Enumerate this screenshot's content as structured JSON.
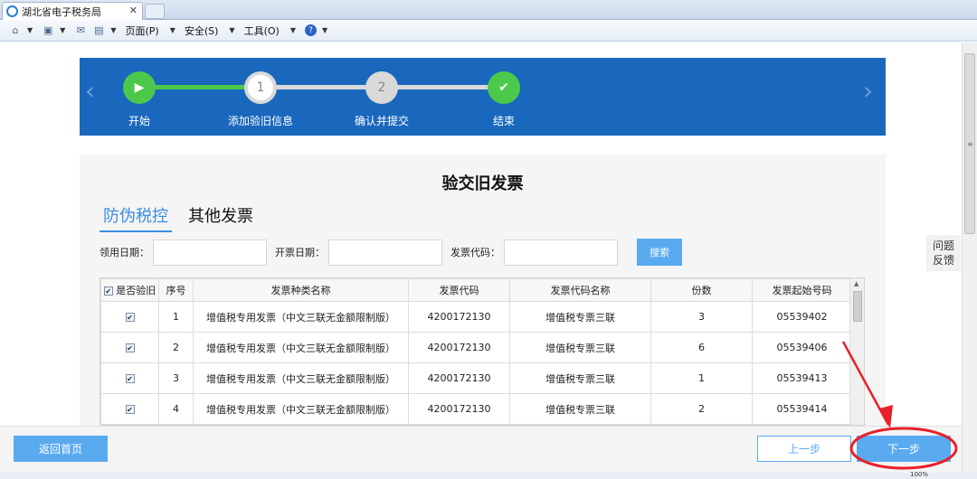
{
  "browser": {
    "tab_title": "湖北省电子税务局",
    "tab_close": "✕",
    "menus": [
      "页面(P)",
      "安全(S)",
      "工具(O)"
    ],
    "help_glyph": "?"
  },
  "steps": {
    "items": [
      {
        "label": "开始",
        "marker": "▶"
      },
      {
        "label": "添加验旧信息",
        "marker": "1"
      },
      {
        "label": "确认并提交",
        "marker": "2"
      },
      {
        "label": "结束",
        "marker": "✔"
      }
    ],
    "nav_prev": "‹",
    "nav_next": "›",
    "colors": {
      "banner": "#1a68bd",
      "done": "#4cc94a",
      "pending": "#d9d9d9"
    }
  },
  "page": {
    "title": "验交旧发票",
    "tabs": {
      "active": "防伪税控",
      "other": "其他发票"
    }
  },
  "filters": {
    "date_label": "领用日期：",
    "issue_date_label": "开票日期：",
    "code_label": "发票代码：",
    "date_value": "",
    "issue_date_value": "",
    "code_value": "",
    "search_button": "搜索"
  },
  "table": {
    "headers": [
      "是否验旧",
      "序号",
      "发票种类名称",
      "发票代码",
      "发票代码名称",
      "份数",
      "发票起始号码"
    ],
    "rows": [
      {
        "checked": true,
        "no": "1",
        "type": "增值税专用发票（中文三联无金额限制版）",
        "code": "4200172130",
        "code_name": "增值税专票三联",
        "count": "3",
        "start_no": "05539402"
      },
      {
        "checked": true,
        "no": "2",
        "type": "增值税专用发票（中文三联无金额限制版）",
        "code": "4200172130",
        "code_name": "增值税专票三联",
        "count": "6",
        "start_no": "05539406"
      },
      {
        "checked": true,
        "no": "3",
        "type": "增值税专用发票（中文三联无金额限制版）",
        "code": "4200172130",
        "code_name": "增值税专票三联",
        "count": "1",
        "start_no": "05539413"
      },
      {
        "checked": true,
        "no": "4",
        "type": "增值税专用发票（中文三联无金额限制版）",
        "code": "4200172130",
        "code_name": "增值税专票三联",
        "count": "2",
        "start_no": "05539414"
      }
    ]
  },
  "feedback": {
    "line1": "问题",
    "line2": "反馈"
  },
  "footer": {
    "home": "返回首页",
    "prev": "上一步",
    "next": "下一步"
  },
  "status": {
    "zoom": "100%"
  }
}
